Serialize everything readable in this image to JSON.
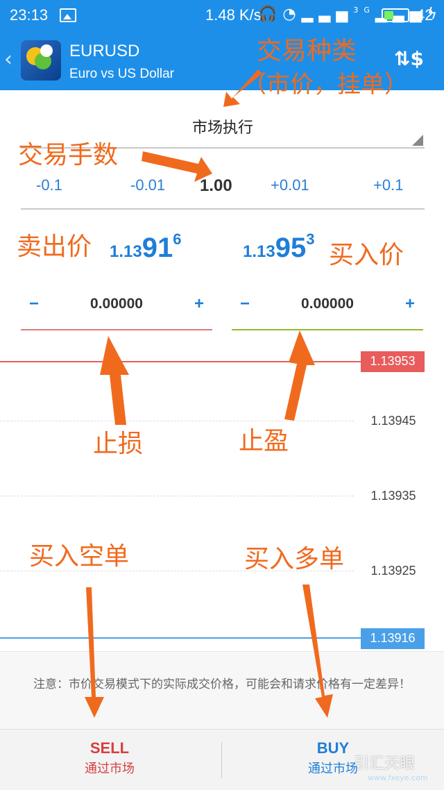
{
  "status_bar": {
    "time": "23:13",
    "net_speed": "1.48 K/s",
    "network": "3G",
    "battery_level": 42,
    "battery_text": "42"
  },
  "header": {
    "symbol": "EURUSD",
    "description": "Euro vs US Dollar"
  },
  "order_type": "市场执行",
  "volume": {
    "minus_01": "-0.1",
    "minus_001": "-0.01",
    "value": "1.00",
    "plus_001": "+0.01",
    "plus_01": "+0.1"
  },
  "prices": {
    "sell_small": "1.13",
    "sell_big": "91",
    "sell_sup": "6",
    "buy_small": "1.13",
    "buy_big": "95",
    "buy_sup": "3"
  },
  "stop_loss": {
    "minus": "−",
    "value": "0.00000",
    "plus": "+"
  },
  "take_profit": {
    "minus": "−",
    "value": "0.00000",
    "plus": "+"
  },
  "chart": {
    "bid_tag": "1.13953",
    "ask_tag": "1.13916",
    "levels": [
      "1.13945",
      "1.13935",
      "1.13925"
    ]
  },
  "note": "注意：市价交易模式下的实际成交价格，可能会和请求价格有一定差异！",
  "actions": {
    "sell_label": "SELL",
    "sell_sub": "通过市场",
    "buy_label": "BUY",
    "buy_sub": "通过市场"
  },
  "watermark": {
    "text": "引汇天眼",
    "sub": "www.fxeye.com"
  },
  "annotations": {
    "order_type_line1": "交易种类",
    "order_type_line2": "（市价，挂单）",
    "volume": "交易手数",
    "sell_price": "卖出价",
    "buy_price": "买入价",
    "stop_loss": "止损",
    "take_profit": "止盈",
    "sell_order": "买入空单",
    "buy_order": "买入多单"
  },
  "colors": {
    "header_bg": "#1e8fe8",
    "annotation": "#f06a1e",
    "sell": "#d64040",
    "buy": "#1e7ed8"
  }
}
